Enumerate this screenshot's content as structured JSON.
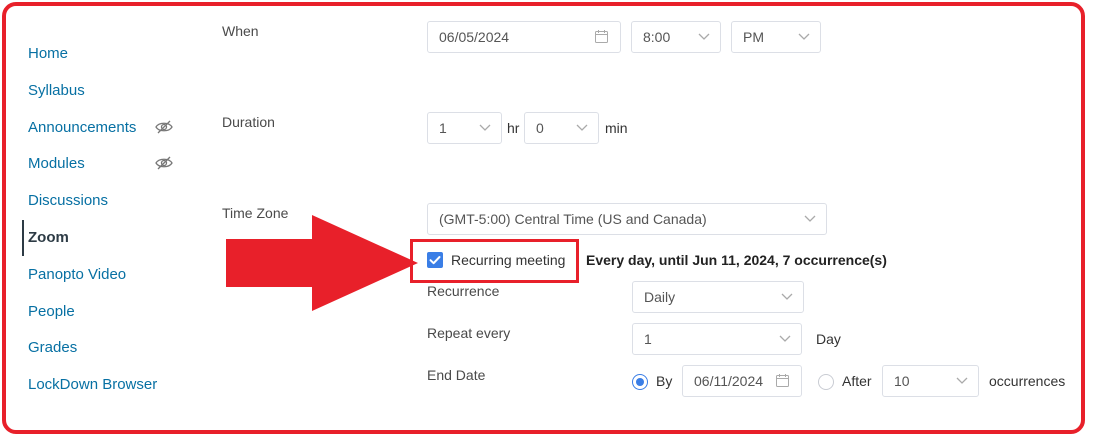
{
  "nav": {
    "items": [
      {
        "label": "Home"
      },
      {
        "label": "Syllabus"
      },
      {
        "label": "Announcements",
        "icon": "eye-off-icon"
      },
      {
        "label": "Modules",
        "icon": "eye-off-icon"
      },
      {
        "label": "Discussions"
      },
      {
        "label": "Zoom",
        "active": true
      },
      {
        "label": "Panopto Video"
      },
      {
        "label": "People"
      },
      {
        "label": "Grades"
      },
      {
        "label": "LockDown Browser"
      }
    ]
  },
  "form": {
    "when": {
      "label": "When",
      "date": "06/05/2024",
      "time": "8:00",
      "ampm": "PM"
    },
    "duration": {
      "label": "Duration",
      "hours": "1",
      "hr_unit": "hr",
      "minutes": "0",
      "min_unit": "min"
    },
    "timezone": {
      "label": "Time Zone",
      "value": "(GMT-5:00) Central Time (US and Canada)"
    },
    "recurring": {
      "label": "Recurring meeting",
      "checked": true,
      "summary": "Every day, until Jun 11, 2024, 7 occurrence(s)"
    },
    "recurrence": {
      "label": "Recurrence",
      "value": "Daily"
    },
    "repeat": {
      "label": "Repeat every",
      "value": "1",
      "unit": "Day"
    },
    "end_date": {
      "label": "End Date",
      "by_label": "By",
      "by_date": "06/11/2024",
      "by_selected": true,
      "after_label": "After",
      "after_count": "10",
      "occurrences_label": "occurrences"
    }
  },
  "colors": {
    "highlight": "#e8202a",
    "link": "#0770a3",
    "accent": "#3a7ee6"
  }
}
